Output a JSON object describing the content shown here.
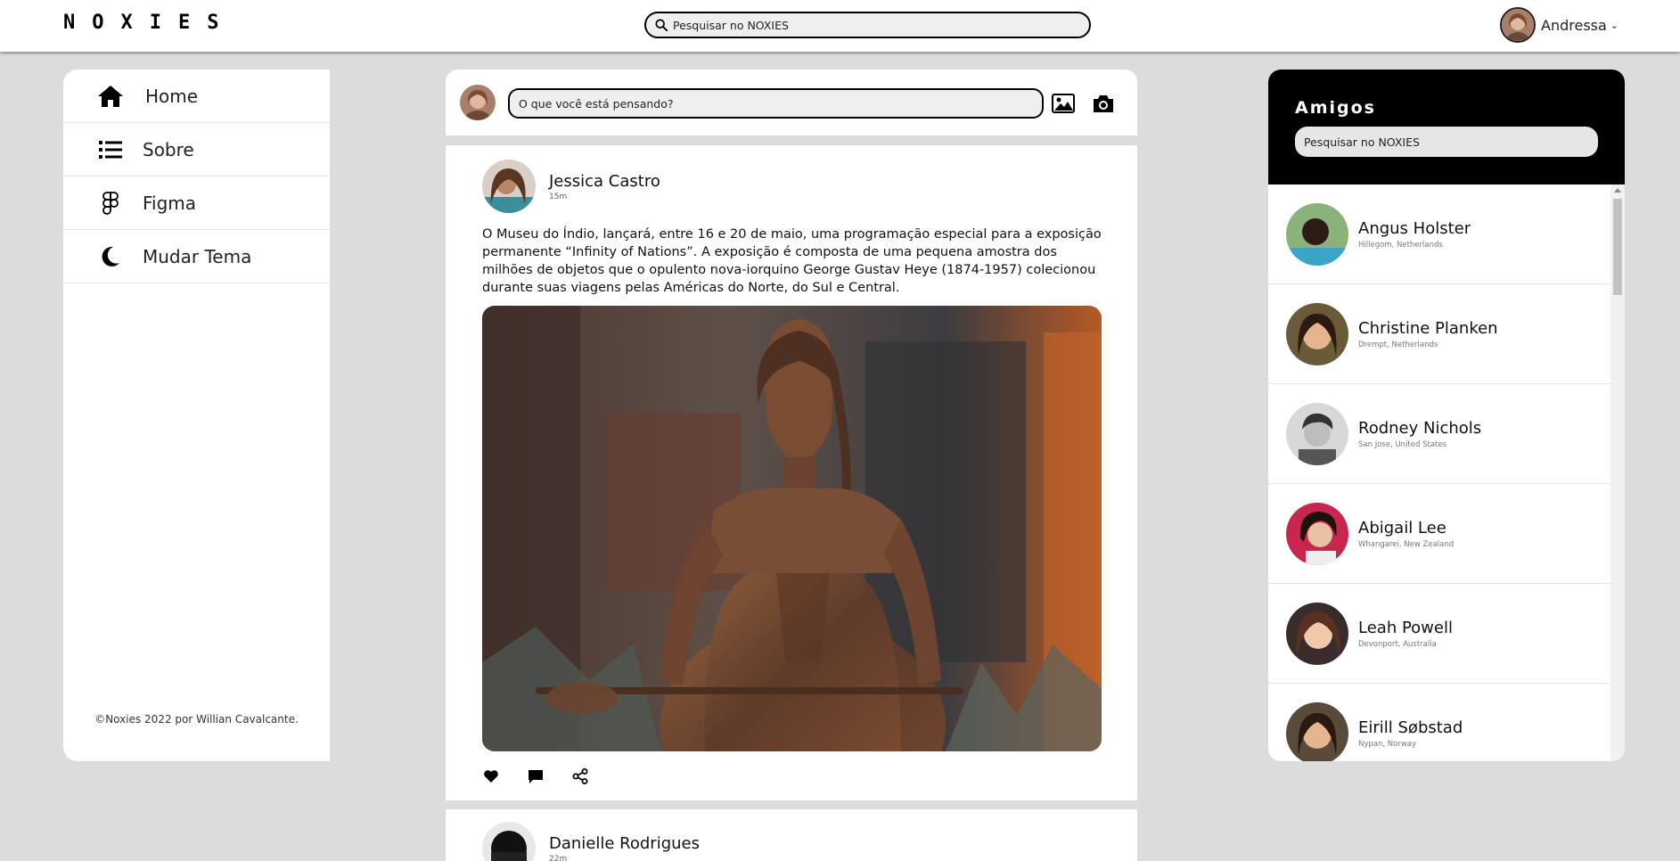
{
  "app": {
    "logo": "NOXIES"
  },
  "header": {
    "search": {
      "placeholder": "Pesquisar no NOXIES",
      "icon": "search-icon"
    },
    "user": {
      "name": "Andressa",
      "chevron": "⌄",
      "chevron_icon": "chevron-down-icon"
    }
  },
  "sidebar": {
    "items": [
      {
        "label": "Home",
        "icon": "home-icon"
      },
      {
        "label": "Sobre",
        "icon": "list-icon"
      },
      {
        "label": "Figma",
        "icon": "figma-icon"
      },
      {
        "label": "Mudar Tema",
        "icon": "moon-icon"
      }
    ],
    "footer": "©Noxies 2022 por Willian Cavalcante."
  },
  "composer": {
    "placeholder": "O que você está pensando?",
    "image_icon": "image-icon",
    "camera_icon": "camera-icon"
  },
  "posts": [
    {
      "author": "Jessica Castro",
      "time": "15m",
      "text": "O Museu do Índio, lançará, entre 16 e 20 de maio, uma programação especial para a exposição permanente “Infinity of Nations”. A exposição é composta de uma pequena amostra dos milhões de objetos que o opulento nova-iorquino George Gustav Heye (1874-1957) colecionou durante suas viagens pelas Américas do Norte, do Sul e Central.",
      "actions": [
        "heart-icon",
        "comment-icon",
        "share-icon"
      ]
    },
    {
      "author": "Danielle Rodrigues",
      "time": "22m"
    }
  ],
  "friends": {
    "title": "Amigos",
    "search_placeholder": "Pesquisar no NOXIES",
    "list": [
      {
        "name": "Angus Holster",
        "location": "Hillegom, Netherlands"
      },
      {
        "name": "Christine Planken",
        "location": "Drempt, Netherlands"
      },
      {
        "name": "Rodney Nichols",
        "location": "San Jose, United States"
      },
      {
        "name": "Abigail Lee",
        "location": "Whangarei, New Zealand"
      },
      {
        "name": "Leah Powell",
        "location": "Devonport, Australia"
      },
      {
        "name": "Eirill Søbstad",
        "location": "Nypan, Norway"
      }
    ]
  },
  "colors": {
    "background": "#dcdcdc",
    "panel": "#ffffff",
    "friends_header": "#000000",
    "input_bg": "#efeff2"
  }
}
